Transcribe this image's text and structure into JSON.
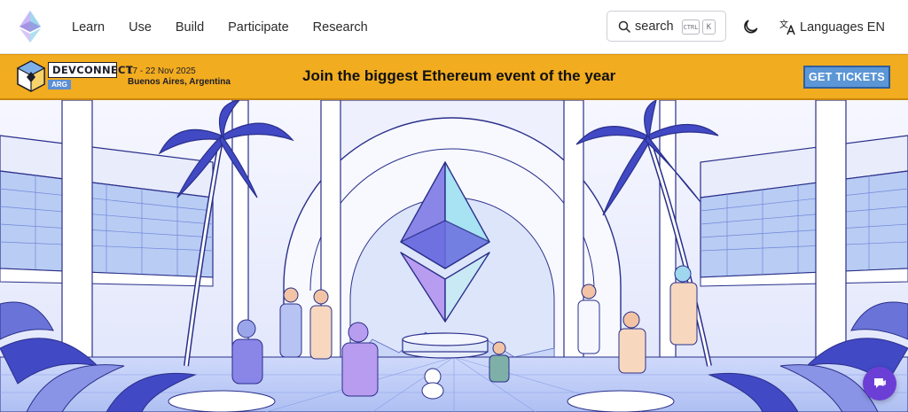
{
  "nav": {
    "links": [
      "Learn",
      "Use",
      "Build",
      "Participate",
      "Research"
    ],
    "search_label": "search",
    "search_shortcut_ctrl": "CTRL",
    "search_shortcut_key": "K",
    "language_label": "Languages EN",
    "logo_icon": "ethereum-logo-icon",
    "theme_icon": "moon-icon",
    "language_icon": "translate-icon"
  },
  "banner": {
    "brand": "DEVCONNECT",
    "brand_tag": "ARG",
    "date": "17 - 22 Nov 2025",
    "location": "Buenos Aires, Argentina",
    "headline": "Join the biggest Ethereum event of the year",
    "cta": "GET TICKETS",
    "background_color": "#f2ac1f",
    "cta_color": "#5b96d6"
  },
  "hero": {
    "illustration": "ethereum-hub-illustration"
  },
  "chat": {
    "icon": "feedback-icon",
    "color": "#6b3fd6"
  }
}
